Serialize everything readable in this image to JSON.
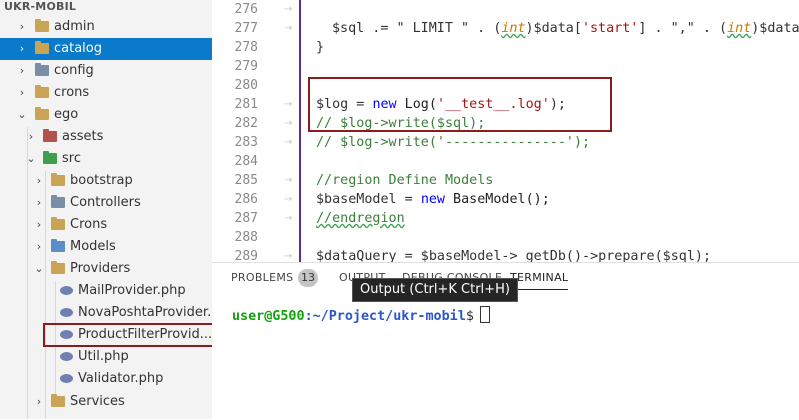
{
  "sidebar": {
    "title": "UKR-MOBIL",
    "items": [
      {
        "label": "admin",
        "chevron": "›",
        "icon": "folder-icon"
      },
      {
        "label": "catalog",
        "chevron": "›",
        "icon": "folder-icon",
        "selected": true
      },
      {
        "label": "config",
        "chevron": "›",
        "icon": "config-folder-icon"
      },
      {
        "label": "crons",
        "chevron": "›",
        "icon": "folder-icon"
      },
      {
        "label": "ego",
        "chevron": "⌄",
        "icon": "folder-open-icon"
      },
      {
        "label": "assets",
        "chevron": "›",
        "icon": "assets-folder-icon"
      },
      {
        "label": "src",
        "chevron": "⌄",
        "icon": "src-folder-icon"
      },
      {
        "label": "bootstrap",
        "chevron": "›",
        "icon": "folder-icon"
      },
      {
        "label": "Controllers",
        "chevron": "›",
        "icon": "controllers-folder-icon"
      },
      {
        "label": "Crons",
        "chevron": "›",
        "icon": "folder-icon"
      },
      {
        "label": "Models",
        "chevron": "›",
        "icon": "models-folder-icon"
      },
      {
        "label": "Providers",
        "chevron": "⌄",
        "icon": "folder-open-icon"
      },
      {
        "label": "MailProvider.php",
        "icon": "php-file-icon"
      },
      {
        "label": "NovaPoshtaProvider...",
        "icon": "php-file-icon"
      },
      {
        "label": "ProductFilterProvid...",
        "icon": "php-file-icon"
      },
      {
        "label": "Util.php",
        "icon": "php-file-icon"
      },
      {
        "label": "Validator.php",
        "icon": "php-file-icon"
      },
      {
        "label": "Services",
        "chevron": "›",
        "icon": "folder-icon"
      }
    ]
  },
  "editor": {
    "line_numbers": [
      "276",
      "277",
      "278",
      "279",
      "280",
      "281",
      "282",
      "283",
      "284",
      "285",
      "286",
      "287",
      "288",
      "289"
    ],
    "code": {
      "l277_a": "$sql .= \" LIMIT \" . (",
      "l277_cast1": "int",
      "l277_b": ")$data[",
      "l277_str1": "'start'",
      "l277_c": "] . \",\" . (",
      "l277_cast2": "int",
      "l277_d": ")$data",
      "l278": "}",
      "l281_a": "$log = ",
      "l281_kw": "new",
      "l281_b": " Log(",
      "l281_str": "'__test__.log'",
      "l281_c": ");",
      "l282": "// $log->write($sql);",
      "l283": "// $log->write('---------------');",
      "l285": "//region Define Models",
      "l286_a": "$baseModel = ",
      "l286_kw": "new",
      "l286_b": " BaseModel();",
      "l287": "//endregion",
      "l289": "$dataQuery = $baseModel-> getDb()->prepare($sql);"
    }
  },
  "panel": {
    "tabs": [
      "PROBLEMS",
      "OUTPUT",
      "DEBUG CONSOLE",
      "TERMINAL"
    ],
    "problems_count": "13",
    "tooltip": "Output (Ctrl+K Ctrl+H)",
    "terminal": {
      "user_host": "user@G500",
      "path": ":~/Project/ukr-mobil",
      "prompt": "$"
    }
  },
  "colors": {
    "selection": "#0a7acb",
    "annotation_box": "#8b1c1c",
    "string": "#a31515",
    "keyword": "#0000ff",
    "comment": "#3b7f3b"
  }
}
